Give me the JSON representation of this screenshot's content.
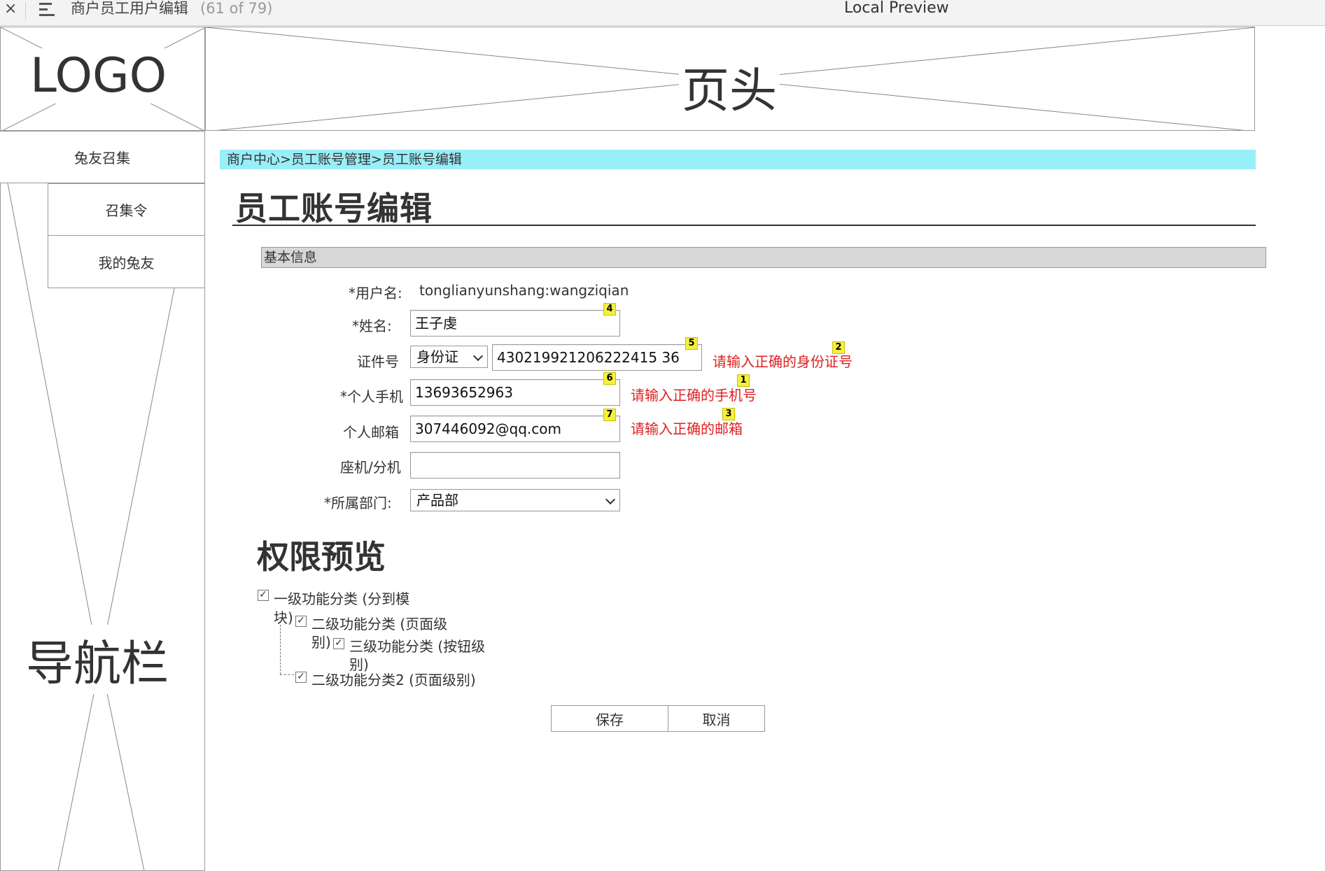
{
  "viewer": {
    "close_glyph": "×",
    "doc_title": "商户员工用户编辑",
    "page_count": "(61 of 79)",
    "preview_label": "Local Preview"
  },
  "wireframe": {
    "logo_text": "LOGO",
    "header_text": "页头",
    "nav_text": "导航栏"
  },
  "nav": {
    "items": [
      {
        "label": "兔友召集"
      },
      {
        "label": "召集令"
      },
      {
        "label": "我的兔友"
      }
    ]
  },
  "breadcrumb": "商户中心>员工账号管理>员工账号编辑",
  "page_title": "员工账号编辑",
  "section_title": "基本信息",
  "form": {
    "username_label": "*用户名:",
    "username_value": "tonglianyunshang:wangziqian",
    "name_label": "*姓名:",
    "name_value": "王子虔",
    "id_label": "证件号",
    "id_type": "身份证",
    "id_value": "430219921206222415 36",
    "id_error": "请输入正确的身份证号",
    "mobile_label": "*个人手机",
    "mobile_value": "13693652963",
    "mobile_error": "请输入正确的手机号",
    "email_label": "个人邮箱",
    "email_value": "307446092@qq.com",
    "email_error": "请输入正确的邮箱",
    "phone_label": "座机/分机",
    "phone_value": "",
    "dept_label": "*所属部门:",
    "dept_value": "产品部"
  },
  "badges": [
    "4",
    "5",
    "2",
    "6",
    "1",
    "7",
    "3"
  ],
  "permissions": {
    "title": "权限预览",
    "level1_a": "一级功能分类 (分到模",
    "level1_b": "块)",
    "level2_a": "二级功能分类 (页面级",
    "level2_b": "别)",
    "level3_a": "三级功能分类 (按钮级",
    "level3_b": "别)",
    "level2b": "二级功能分类2 (页面级别)",
    "check_glyph": "✓"
  },
  "actions": {
    "save": "保存",
    "cancel": "取消"
  },
  "colors": {
    "breadcrumb_bg": "#99eef8",
    "error": "#e02020",
    "badge": "#f5f03c",
    "section_bg": "#d7d7d7"
  }
}
